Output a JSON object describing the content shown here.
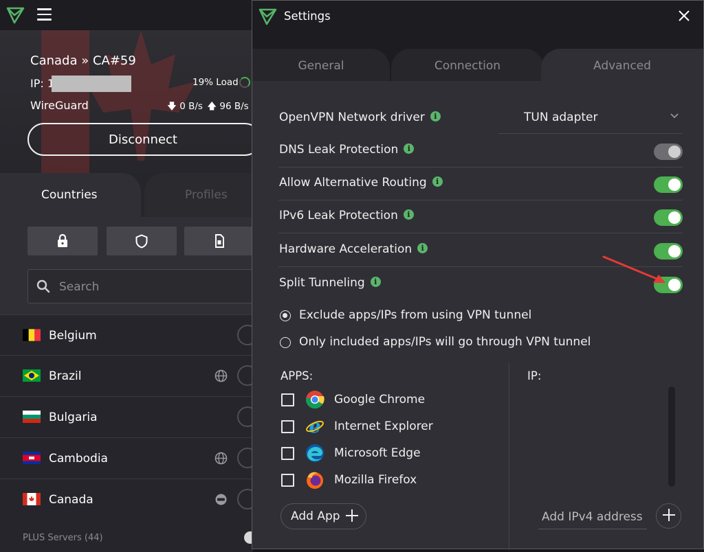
{
  "main": {
    "connection": {
      "server": "Canada » CA#59",
      "ip_label": "IP: 1",
      "load": "19% Load",
      "protocol": "WireGuard",
      "down_speed": "0 B/s",
      "up_speed": "96 B/s",
      "disconnect_label": "Disconnect"
    },
    "tabs": {
      "countries": "Countries",
      "profiles": "Profiles"
    },
    "search": {
      "placeholder": "Search"
    },
    "countries": [
      {
        "name": "Belgium"
      },
      {
        "name": "Brazil"
      },
      {
        "name": "Bulgaria"
      },
      {
        "name": "Cambodia"
      },
      {
        "name": "Canada"
      }
    ],
    "plus_servers": "PLUS Servers (44)"
  },
  "settings": {
    "title": "Settings",
    "tabs": {
      "general": "General",
      "connection": "Connection",
      "advanced": "Advanced"
    },
    "openvpn_driver": {
      "label": "OpenVPN Network driver",
      "value": "TUN adapter"
    },
    "rows": [
      {
        "label": "DNS Leak Protection",
        "enabled": false
      },
      {
        "label": "Allow Alternative Routing",
        "enabled": true
      },
      {
        "label": "IPv6 Leak Protection",
        "enabled": true
      },
      {
        "label": "Hardware Acceleration",
        "enabled": true
      },
      {
        "label": "Split Tunneling",
        "enabled": true
      }
    ],
    "split_modes": [
      {
        "label": "Exclude apps/IPs from using VPN tunnel",
        "selected": true
      },
      {
        "label": "Only included apps/IPs will go through VPN tunnel",
        "selected": false
      }
    ],
    "apps_title": "APPS:",
    "apps": [
      {
        "name": "Google Chrome",
        "icon": "chrome-icon"
      },
      {
        "name": "Internet Explorer",
        "icon": "internet-explorer-icon"
      },
      {
        "name": "Microsoft Edge",
        "icon": "edge-icon"
      },
      {
        "name": "Mozilla Firefox",
        "icon": "firefox-icon"
      }
    ],
    "add_app_label": "Add App",
    "ip_title": "IP:",
    "ipv4_placeholder": "Add IPv4 address"
  },
  "colors": {
    "accent_green": "#4caf50",
    "annotation_arrow": "#e53935"
  }
}
